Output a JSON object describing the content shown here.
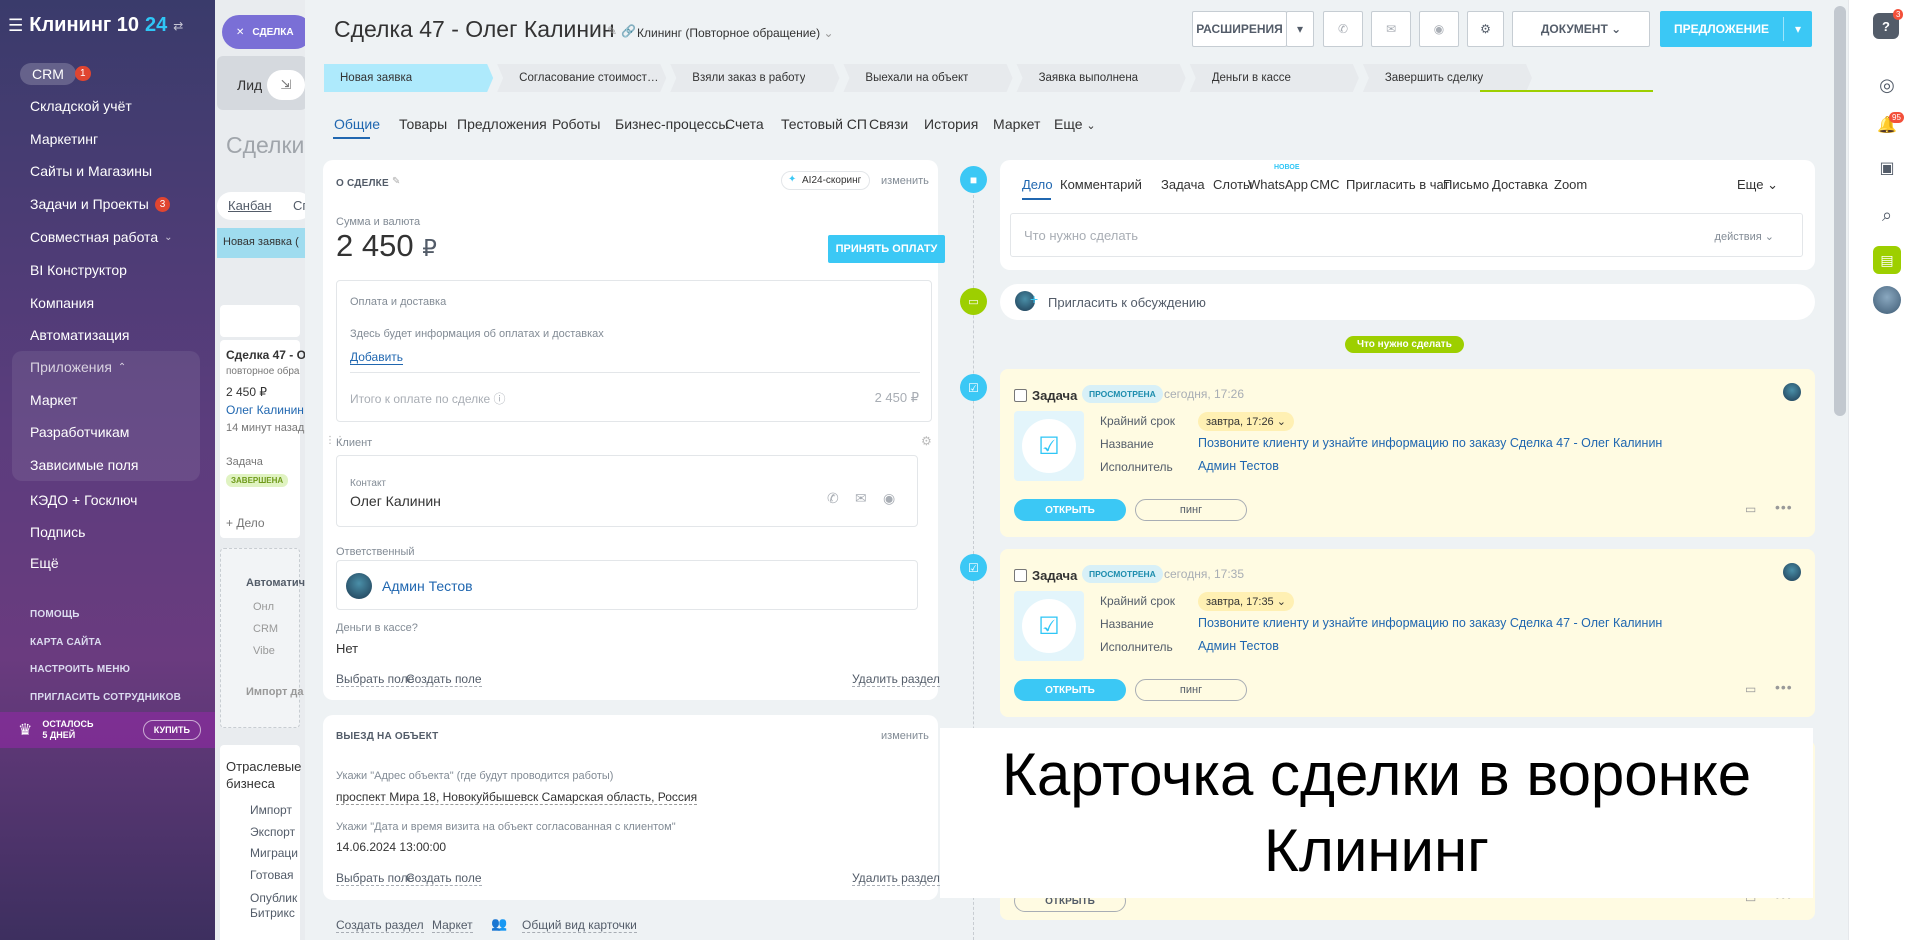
{
  "app": {
    "logo_text": "Клининг 10",
    "logo_num": "24"
  },
  "sidebar": {
    "crm_label": "CRM",
    "crm_badge": "1",
    "items": [
      {
        "label": "Складской учёт"
      },
      {
        "label": "Маркетинг"
      },
      {
        "label": "Сайты и Магазины"
      },
      {
        "label": "Задачи и Проекты",
        "badge": "3"
      },
      {
        "label": "Совместная работа"
      },
      {
        "label": "BI Конструктор"
      },
      {
        "label": "Компания"
      },
      {
        "label": "Автоматизация"
      },
      {
        "label": "Приложения"
      },
      {
        "label": "Маркет"
      },
      {
        "label": "Разработчикам"
      },
      {
        "label": "Зависимые поля"
      },
      {
        "label": "КЭДО + Госключ"
      },
      {
        "label": "Подпись"
      },
      {
        "label": "Ещё"
      }
    ],
    "small_links": [
      "ПОМОЩЬ",
      "КАРТА САЙТА",
      "НАСТРОИТЬ МЕНЮ",
      "ПРИГЛАСИТЬ СОТРУДНИКОВ"
    ],
    "trial_line1": "ОСТАЛОСЬ",
    "trial_line2": "5 ДНЕЙ",
    "buy_label": "КУПИТЬ"
  },
  "background": {
    "close_label": "СДЕЛКА",
    "lid": "Лид",
    "deals": "Сделки",
    "kanban": "Канбан",
    "kanban_more": "Сп",
    "column": "Новая заявка (",
    "card_title": "Сделка 47 - О",
    "card_sub": "повторное обра",
    "card_sum": "2 450 ₽",
    "card_contact": "Олег Калинин",
    "card_time": "14 минут назад",
    "card_task": "Задача",
    "card_status": "ЗАВЕРШЕНА",
    "add_deal": "+ Дело",
    "auto": "Автоматич",
    "on": "Онл",
    "crm2": "CRM",
    "viber": "Vibe",
    "import": "Импорт да",
    "industry": "Отраслевые",
    "business": "бизнеса",
    "links": [
      "Импорт",
      "Экспорт",
      "Миграци",
      "Готовая",
      "Опублик",
      "Битрикс"
    ]
  },
  "deal": {
    "title": "Сделка 47 - Олег Калинин",
    "pipeline": "Клининг (Повторное обращение)",
    "btn_extensions": "РАСШИРЕНИЯ",
    "btn_document": "ДОКУМЕНТ",
    "btn_proposal": "ПРЕДЛОЖЕНИЕ"
  },
  "stages": [
    {
      "label": "Новая заявка",
      "color": "#aeeafc"
    },
    {
      "label": "Согласование стоимости работ и у...",
      "color": "#e7eaed"
    },
    {
      "label": "Взяли заказ в работу",
      "color": "#e7eaed"
    },
    {
      "label": "Выехали на объект",
      "color": "#e7eaed"
    },
    {
      "label": "Заявка выполнена",
      "color": "#e7eaed"
    },
    {
      "label": "Деньги в кассе",
      "color": "#e7eaed"
    },
    {
      "label": "Завершить сделку",
      "color": "#e7eaed"
    }
  ],
  "tabs": [
    "Общие",
    "Товары",
    "Предложения",
    "Роботы",
    "Бизнес-процессы",
    "Счета",
    "Тестовый СП",
    "Связи",
    "История",
    "Маркет",
    "Еще"
  ],
  "about": {
    "title": "О СДЕЛКЕ",
    "ai": "AI24-скоринг",
    "edit": "изменить",
    "sum_label": "Сумма и валюта",
    "sum": "2 450",
    "currency": "₽",
    "accept": "ПРИНЯТЬ ОПЛАТУ",
    "payment_label": "Оплата и доставка",
    "payment_info": "Здесь будет информация об оплатах и доставках",
    "add": "Добавить",
    "total_label": "Итого к оплате по сделке",
    "total": "2 450 ₽",
    "client_label": "Клиент",
    "contact_label": "Контакт",
    "contact": "Олег Калинин",
    "resp_label": "Ответственный",
    "resp": "Админ Тестов",
    "cash_label": "Деньги в кассе?",
    "cash": "Нет",
    "choose_field": "Выбрать поле",
    "create_field": "Создать поле",
    "delete_section": "Удалить раздел"
  },
  "visit": {
    "title": "ВЫЕЗД НА ОБЪЕКТ",
    "edit": "изменить",
    "addr_label": "Укажи \"Адрес объекта\" (где будут проводится работы)",
    "addr": "проспект Мира 18, Новокуйбышевск Самарская область, Россия",
    "date_label": "Укажи \"Дата и время визита на объект согласованная с клиентом\"",
    "date": "14.06.2024 13:00:00",
    "choose_field": "Выбрать поле",
    "create_field": "Создать поле",
    "delete_section": "Удалить раздел"
  },
  "bottom": {
    "create_section": "Создать раздел",
    "market": "Маркет",
    "common_view": "Общий вид карточки"
  },
  "activity": {
    "tabs": [
      "Дело",
      "Комментарий",
      "Задача",
      "Слоты",
      "WhatsApp",
      "СМС",
      "Пригласить в чат",
      "Письмо",
      "Доставка",
      "Zoom",
      "Еще"
    ],
    "new_badge": "НОВОЕ",
    "placeholder": "Что нужно сделать",
    "actions": "действия",
    "invite": "Пригласить к обсуждению",
    "todo": "Что нужно сделать"
  },
  "tasks": [
    {
      "title": "Задача",
      "viewed": "ПРОСМОТРЕНА",
      "time": "сегодня, 17:26",
      "deadline_label": "Крайний срок",
      "deadline": "завтра, 17:26",
      "name_label": "Название",
      "name": "Позвоните клиенту и узнайте информацию по заказу Сделка 47 - Олег Калинин",
      "exec_label": "Исполнитель",
      "exec": "Админ Тестов",
      "open": "ОТКРЫТЬ",
      "ping": "пинг"
    },
    {
      "title": "Задача",
      "viewed": "ПРОСМОТРЕНА",
      "time": "сегодня, 17:35",
      "deadline_label": "Крайний срок",
      "deadline": "завтра, 17:35",
      "name_label": "Название",
      "name": "Позвоните клиенту и узнайте информацию по заказу Сделка 47 - Олег Калинин",
      "exec_label": "Исполнитель",
      "exec": "Админ Тестов",
      "open": "ОТКРЫТЬ",
      "ping": "пинг"
    }
  ],
  "third_open": "ОТКРЫТЬ",
  "overlay": {
    "line1": "Карточка сделки в воронке",
    "line2": "Клининг"
  },
  "right_badges": {
    "help": "3",
    "notif": "95"
  }
}
